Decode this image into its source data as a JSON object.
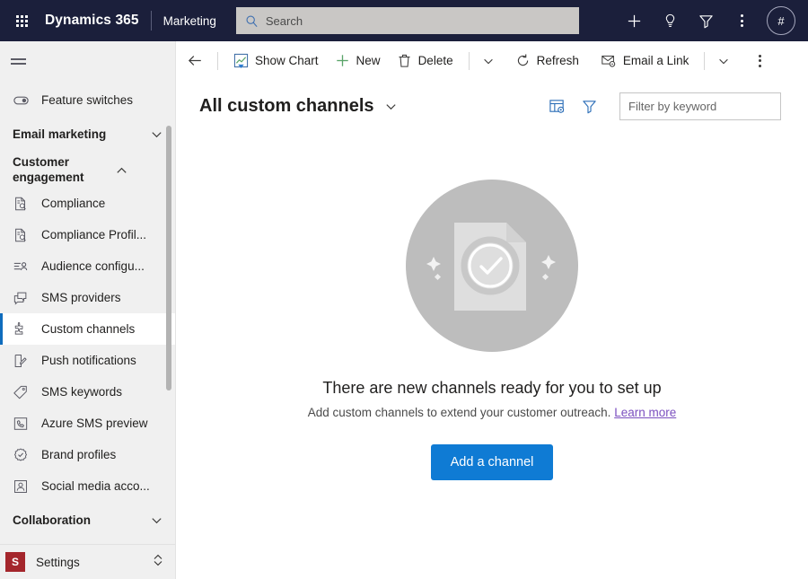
{
  "topbar": {
    "waffle_label": "app-launcher",
    "brand": "Dynamics 365",
    "app_name": "Marketing",
    "search_placeholder": "Search",
    "icons": [
      "plus-icon",
      "lightbulb-icon",
      "filter-icon",
      "more-vertical-icon"
    ],
    "avatar_text": "#"
  },
  "commandbar": {
    "back_label": "back-arrow",
    "show_chart": "Show Chart",
    "new": "New",
    "delete": "Delete",
    "refresh": "Refresh",
    "email_a_link": "Email a Link",
    "overflow_label": "more-commands"
  },
  "view": {
    "title": "All custom channels",
    "edit_columns_label": "edit-columns",
    "edit_filters_label": "edit-filters",
    "filter_placeholder": "Filter by keyword",
    "filter_value": ""
  },
  "sidebar": {
    "hamburger_label": "site-map-toggle",
    "top_item": {
      "label": "Feature switches",
      "icon": "toggle-icon"
    },
    "groups": [
      {
        "label": "Email marketing",
        "state": "collapsed",
        "chevron": "chevron-down-icon"
      },
      {
        "label": "Customer engagement",
        "state": "expanded",
        "chevron": "chevron-up-icon"
      }
    ],
    "items": [
      {
        "label": "Compliance",
        "icon": "document-search-icon",
        "selected": false
      },
      {
        "label": "Compliance Profil...",
        "icon": "document-search-icon",
        "selected": false
      },
      {
        "label": "Audience configu...",
        "icon": "audience-icon",
        "selected": false
      },
      {
        "label": "SMS providers",
        "icon": "chat-bubbles-icon",
        "selected": false
      },
      {
        "label": "Custom channels",
        "icon": "puzzle-piece-icon",
        "selected": true
      },
      {
        "label": "Push notifications",
        "icon": "push-notification-icon",
        "selected": false
      },
      {
        "label": "SMS keywords",
        "icon": "tag-icon",
        "selected": false
      },
      {
        "label": "Azure SMS preview",
        "icon": "phone-device-icon",
        "selected": false
      },
      {
        "label": "Brand profiles",
        "icon": "badge-check-icon",
        "selected": false
      },
      {
        "label": "Social media acco...",
        "icon": "person-frame-icon",
        "selected": false
      }
    ],
    "bottom_group": {
      "label": "Collaboration",
      "state": "collapsed",
      "chevron": "chevron-down-icon"
    },
    "settings": {
      "badge": "S",
      "label": "Settings",
      "chevron": "chevron-up-down-icon"
    }
  },
  "empty_state": {
    "illustration": "document-check-circle-illustration",
    "title": "There are new channels ready for you to set up",
    "subtitle_text": "Add custom channels to extend your customer outreach.",
    "link_text": "Learn more",
    "button_label": "Add a channel"
  },
  "colors": {
    "topbar_bg": "#1b1f3b",
    "accent_blue": "#0f7bd4",
    "nav_selected_rail": "#0f6cbd",
    "settings_badge": "#a4262c",
    "link_purple": "#7b4fbf",
    "sidebar_bg": "#f0f0f0"
  }
}
